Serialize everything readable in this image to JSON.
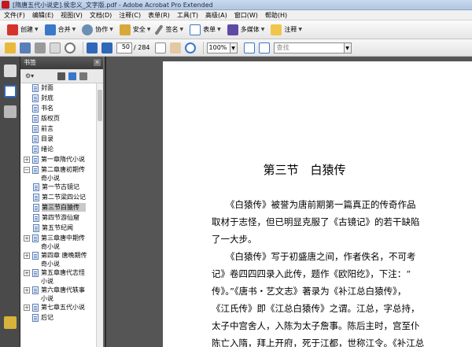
{
  "window": {
    "title": "[隋唐五代小说史].侯忠义_文字版.pdf - Adobe Acrobat Pro Extended"
  },
  "menu": {
    "items": [
      "文件(F)",
      "编辑(E)",
      "视图(V)",
      "文档(D)",
      "注释(C)",
      "表单(R)",
      "工具(T)",
      "高级(A)",
      "窗口(W)",
      "帮助(H)"
    ]
  },
  "toolbar": {
    "create": "创建",
    "merge": "合并",
    "collaborate": "协作",
    "secure": "安全",
    "sign": "签名",
    "forms": "表单",
    "multimedia": "多媒体",
    "comment": "注释"
  },
  "nav": {
    "page_current": "50",
    "page_total": "/ 284",
    "zoom": "100%",
    "find_placeholder": "查找"
  },
  "bookmarks": {
    "title": "书签",
    "options_label": "",
    "items": [
      {
        "label": "封面",
        "level": 1,
        "expander": ""
      },
      {
        "label": "封底",
        "level": 1,
        "expander": ""
      },
      {
        "label": "书名",
        "level": 1,
        "expander": ""
      },
      {
        "label": "版权页",
        "level": 1,
        "expander": ""
      },
      {
        "label": "前言",
        "level": 1,
        "expander": ""
      },
      {
        "label": "目录",
        "level": 1,
        "expander": ""
      },
      {
        "label": "绪论",
        "level": 1,
        "expander": ""
      },
      {
        "label": "第一章隋代小说",
        "level": 1,
        "expander": "+"
      },
      {
        "label": "第二章唐初期传奇小说",
        "level": 1,
        "expander": "−"
      },
      {
        "label": "第一节古镜记",
        "level": 2,
        "expander": ""
      },
      {
        "label": "第二节梁四公记",
        "level": 2,
        "expander": ""
      },
      {
        "label": "第三节白猿传",
        "level": 2,
        "expander": "",
        "selected": true
      },
      {
        "label": "第四节游仙窟",
        "level": 2,
        "expander": ""
      },
      {
        "label": "第五节纪闻",
        "level": 2,
        "expander": ""
      },
      {
        "label": "第三章唐中期传奇小说",
        "level": 1,
        "expander": "+"
      },
      {
        "label": "第四章 唐晚期传奇小说",
        "level": 1,
        "expander": "+"
      },
      {
        "label": "第五章唐代志怪小说",
        "level": 1,
        "expander": "+"
      },
      {
        "label": "第六章唐代轶事小说",
        "level": 1,
        "expander": "+"
      },
      {
        "label": "第七章五代小说",
        "level": 1,
        "expander": "+"
      },
      {
        "label": "后记",
        "level": 1,
        "expander": ""
      }
    ]
  },
  "document": {
    "heading": "第三节　白猿传",
    "lines": [
      "《白猿传》被誉为唐前期第一篇真正的传奇作品",
      "取材于志怪，但已明显克服了《古镜记》的若干缺陷",
      "了一大步。",
      "《白猿传》写于初盛唐之间，作者佚名，不可考",
      "记》卷四四四录入此传，题作《欧阳纥》，下注：“",
      "传》。”《唐书・艺文志》著录为《补江总白猿传》，",
      "《江氏传》即《江总白猿传》之谓。江总，字总持，",
      "太子中宫舍人，入陈为太子詹事。陈后主时，宫至仆",
      "陈亡入隋，拜上开府，死于江都，世称江令。《补江总"
    ]
  },
  "colors": {
    "accent_blue": "#2f68b8",
    "pdf_red": "#c0181d",
    "panel_dark": "#3c3c3c"
  }
}
